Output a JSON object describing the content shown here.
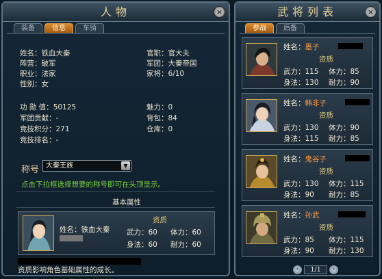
{
  "left_panel": {
    "title": "人物",
    "tabs": [
      "装备",
      "信息",
      "车骑"
    ],
    "active_tab": 1,
    "info": {
      "name_label": "姓名：",
      "name_value": "铁血大秦",
      "camp_label": "阵营：",
      "camp_value": "破军",
      "job_label": "职业：",
      "job_value": "法家",
      "gender_label": "性别：",
      "gender_value": "女",
      "rank_label": "官职：",
      "rank_value": "官大夫",
      "legion_label": "军团：",
      "legion_value": "大秦帝国",
      "generals_label": "家将：",
      "generals_value": "6/10",
      "merit_label": "功 勋 值：",
      "merit_value": "50125",
      "contrib_label": "军团贡献：",
      "contrib_value": "-",
      "arena_points_label": "竞技积分：",
      "arena_points_value": "271",
      "arena_rank_label": "竞技排名：",
      "arena_rank_value": "-",
      "charm_label": "魅力：",
      "charm_value": "0",
      "bag_label": "背包：",
      "bag_value": "84",
      "storage_label": "仓库：",
      "storage_value": "0"
    },
    "title_label": "称号",
    "title_select": "大秦王族",
    "hint": "点击下拉框选择想要的称号即可在头顶显示。",
    "section_title": "基本属性",
    "char_card": {
      "name_label": "姓名：",
      "name_value": "铁血大秦",
      "quality": "资质",
      "wuli_label": "武力：",
      "wuli_value": "60",
      "tili_label": "体力：",
      "tili_value": "60",
      "shenfa_label": "身法：",
      "shenfa_value": "60",
      "naili_label": "耐力：",
      "naili_value": "60"
    },
    "footer": "资质影响角色基础属性的成长。"
  },
  "right_panel": {
    "title": "武将列表",
    "tabs": [
      "参战",
      "后备"
    ],
    "active_tab": 0,
    "generals": [
      {
        "name_label": "姓名：",
        "name": "墨子",
        "quality": "资质",
        "wuli_label": "武力：",
        "wuli": "115",
        "tili_label": "体力：",
        "tili": "85",
        "shenfa_label": "身法：",
        "shenfa": "130",
        "naili_label": "耐力：",
        "naili": "90"
      },
      {
        "name_label": "姓名：",
        "name": "韩非子",
        "quality": "资质",
        "wuli_label": "武力：",
        "wuli": "130",
        "tili_label": "体力：",
        "tili": "90",
        "shenfa_label": "身法：",
        "shenfa": "115",
        "naili_label": "耐力：",
        "naili": "85"
      },
      {
        "name_label": "姓名：",
        "name": "鬼谷子",
        "quality": "资质",
        "wuli_label": "武力：",
        "wuli": "130",
        "tili_label": "体力：",
        "tili": "115",
        "shenfa_label": "身法：",
        "shenfa": "90",
        "naili_label": "耐力：",
        "naili": "85"
      },
      {
        "name_label": "姓名：",
        "name": "孙武",
        "quality": "资质",
        "wuli_label": "武力：",
        "wuli": "85",
        "tili_label": "体力：",
        "tili": "115",
        "shenfa_label": "身法：",
        "shenfa": "90",
        "naili_label": "耐力：",
        "naili": "130"
      }
    ],
    "pager": {
      "label": "1/1",
      "prev": "‹",
      "next": "›"
    }
  },
  "icons": {
    "close": "×",
    "dropdown": "▼"
  }
}
